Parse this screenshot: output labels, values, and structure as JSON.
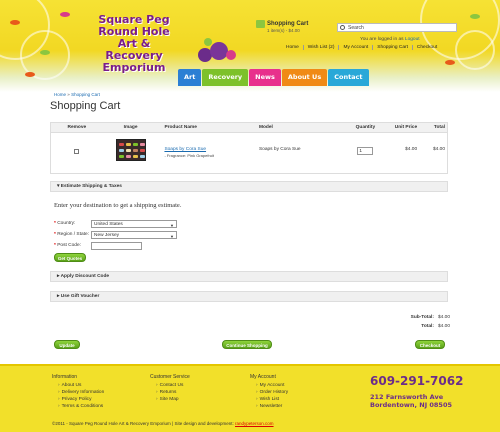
{
  "header": {
    "logo_lines": [
      "Square Peg",
      "Round Hole",
      "Art & Recovery",
      "Emporium"
    ],
    "cart_title": "Shopping Cart",
    "cart_summary": "1 item(s) - $4.00",
    "search_placeholder": "Search",
    "logged_in_prefix": "You are logged in as ",
    "logged_in_user": "Logout",
    "top_links": [
      "Home",
      "Wish List (2)",
      "My Account",
      "Shopping Cart",
      "Checkout"
    ],
    "nav": [
      {
        "label": "Art",
        "color": "#2b7fd4"
      },
      {
        "label": "Recovery",
        "color": "#7dc12a"
      },
      {
        "label": "News",
        "color": "#e8308c"
      },
      {
        "label": "About Us",
        "color": "#f08a15"
      },
      {
        "label": "Contact",
        "color": "#29a8d8"
      }
    ]
  },
  "breadcrumb": {
    "home": "Home",
    "sep": "»",
    "current": "Shopping Cart"
  },
  "page_title": "Shopping Cart",
  "cart_table": {
    "headers": [
      "Remove",
      "Image",
      "Product Name",
      "Model",
      "Quantity",
      "Unit Price",
      "Total"
    ],
    "rows": [
      {
        "product": "Soaps by Cora Sue",
        "option": "- Fragrance: Pink Grapefruit",
        "model": "Soaps by Cora Sue",
        "quantity": "1",
        "unit_price": "$4.00",
        "total": "$4.00"
      }
    ]
  },
  "shipping": {
    "section_title": "Estimate Shipping & Taxes",
    "intro": "Enter your destination to get a shipping estimate.",
    "country_label": "Country:",
    "country_value": "United States",
    "region_label": "Region / State:",
    "region_value": "New Jersey",
    "postcode_label": "Post Code:",
    "postcode_value": "",
    "get_quotes": "Get Quotes"
  },
  "discount_title": "Apply Discount Code",
  "voucher_title": "Use Gift Voucher",
  "totals": [
    {
      "label": "Sub-Total:",
      "value": "$4.00"
    },
    {
      "label": "Total:",
      "value": "$4.00"
    }
  ],
  "buttons": {
    "update": "Update",
    "continue": "Continue Shopping",
    "checkout": "Checkout"
  },
  "footer": {
    "information": {
      "title": "Information",
      "items": [
        "About Us",
        "Delivery Information",
        "Privacy Policy",
        "Terms & Conditions"
      ]
    },
    "customer_service": {
      "title": "Customer Service",
      "items": [
        "Contact Us",
        "Returns",
        "Site Map"
      ]
    },
    "my_account": {
      "title": "My Account",
      "items": [
        "My Account",
        "Order History",
        "Wish List",
        "Newsletter"
      ]
    },
    "phone": "609-291-7062",
    "address_line1": "212 Farnsworth Ave",
    "address_line2": "Bordentown, NJ 08505",
    "copyright": "©2011 - Square Peg Round Hole Art & Recovery Emporium  |  Site design and development: ",
    "designer": "randypeterson.com"
  }
}
